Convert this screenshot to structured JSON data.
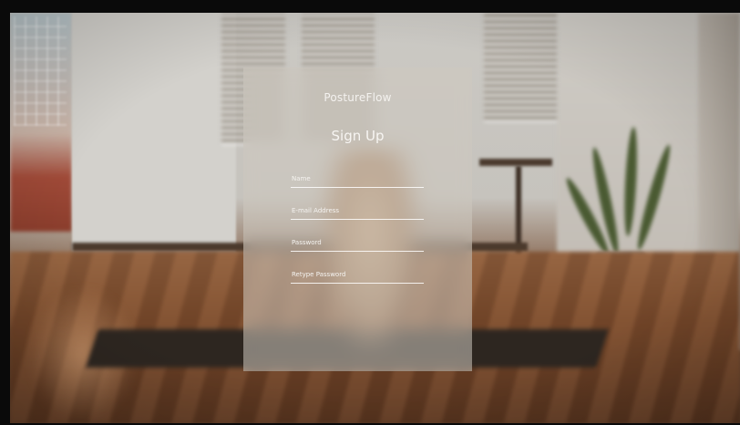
{
  "app": {
    "brand": "PostureFlow"
  },
  "signup": {
    "title": "Sign Up",
    "fields": [
      {
        "placeholder": "Name",
        "value": ""
      },
      {
        "placeholder": "E-mail Address",
        "value": ""
      },
      {
        "placeholder": "Password",
        "value": ""
      },
      {
        "placeholder": "Retype Password",
        "value": ""
      }
    ]
  },
  "colors": {
    "panel_tint": "#CDC8C0",
    "text": "#F4F2EF",
    "underline": "#FFFFFF"
  },
  "background": {
    "icon": "yoga-studio-photo"
  }
}
